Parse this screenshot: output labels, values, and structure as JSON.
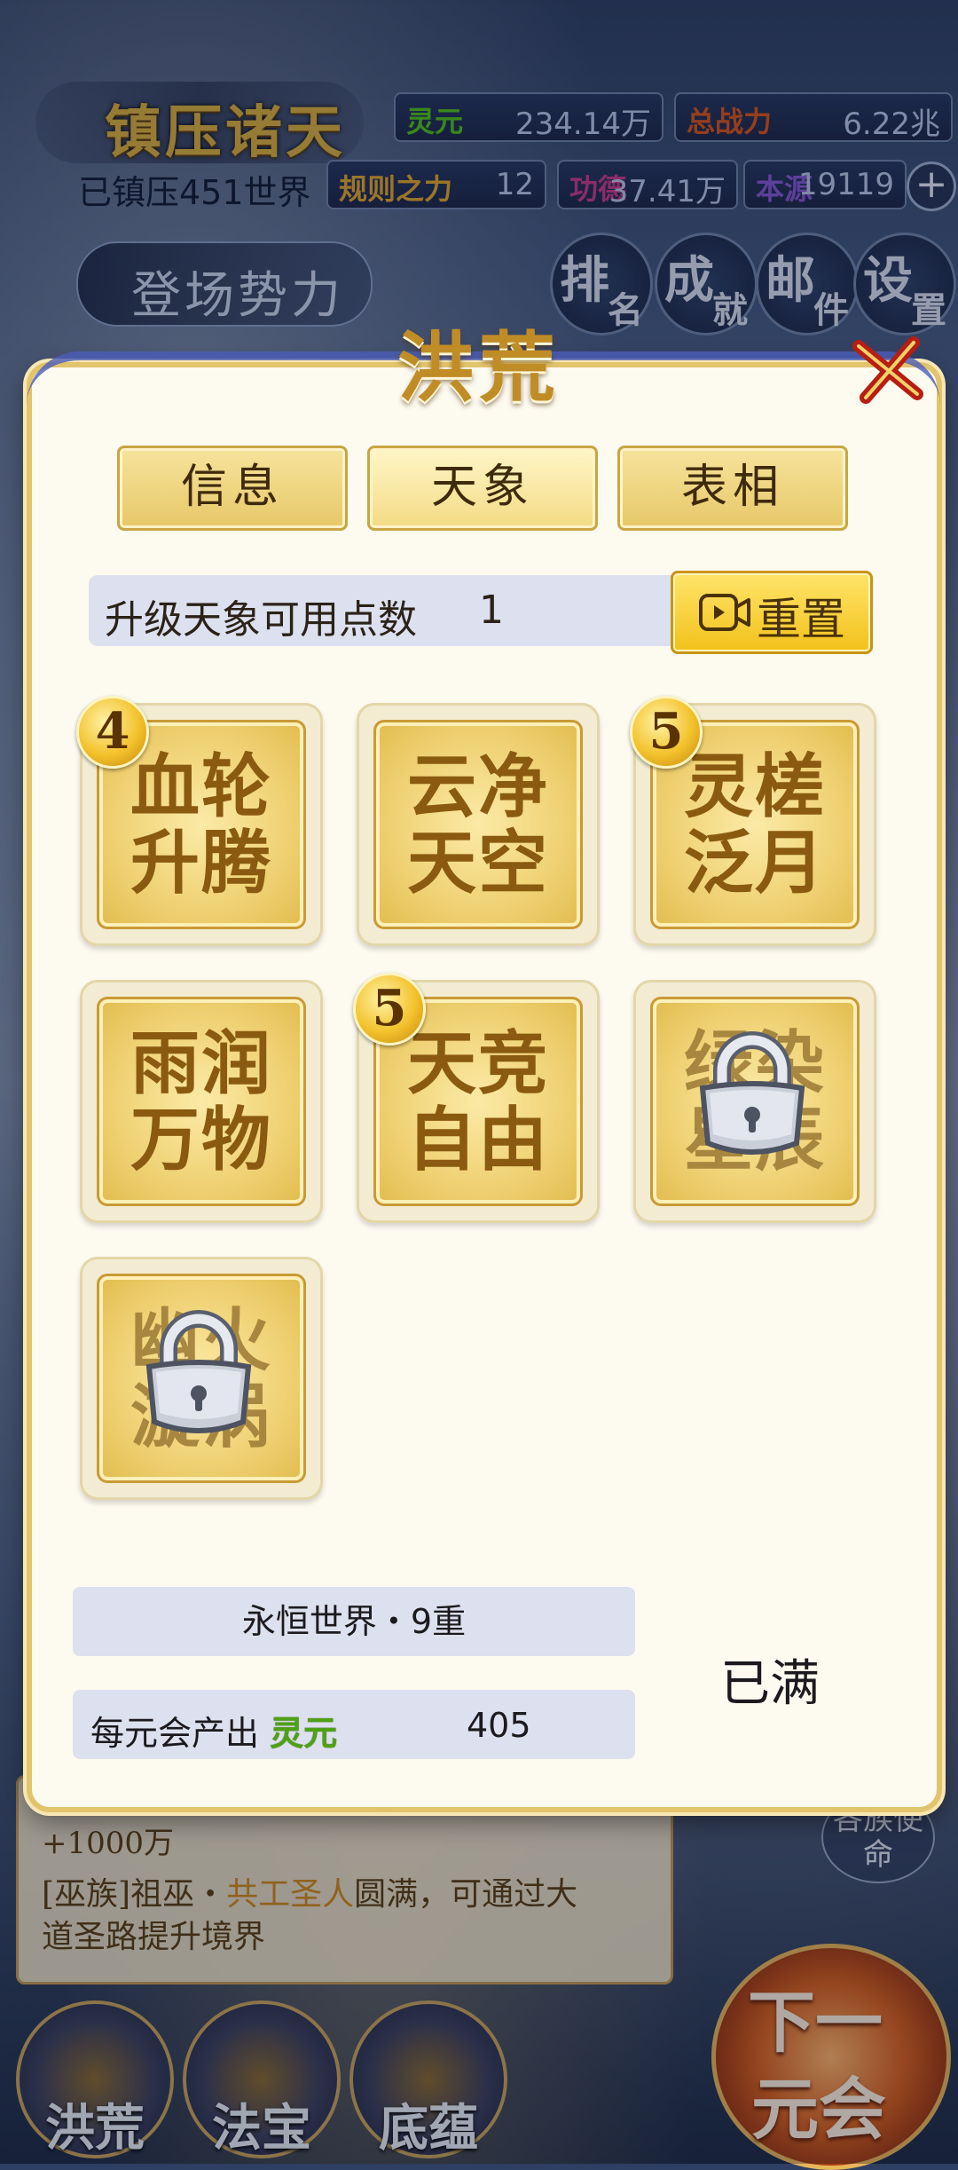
{
  "hud": {
    "title": "镇压诸天",
    "subtitle": "已镇压451世界",
    "stats": [
      {
        "label": "灵元",
        "value": "234.14万",
        "color": "#4fc21a"
      },
      {
        "label": "总战力",
        "value": "6.22兆",
        "color": "#d8541a"
      },
      {
        "label": "规则之力",
        "value": "12",
        "color": "#e0a52b"
      },
      {
        "label": "功德",
        "value": "37.41万",
        "color": "#c73a8a"
      },
      {
        "label": "本源",
        "value": "19119",
        "color": "#8457d3"
      }
    ],
    "plus": "+",
    "faction_button": "登场势力",
    "buttons": [
      {
        "main": "排",
        "small": "名"
      },
      {
        "main": "成",
        "small": "就"
      },
      {
        "main": "邮",
        "small": "件"
      },
      {
        "main": "设",
        "small": "置"
      }
    ]
  },
  "background": {
    "line1": "+1000万",
    "line2_prefix": "[巫族]祖巫・",
    "line2_highlight": "共工圣人",
    "line2_suffix": "圆满，可通过大",
    "line3": "道圣路提升境界",
    "mission": "各族使命",
    "nav": [
      "洪荒",
      "法宝",
      "底蕴"
    ],
    "next_button": [
      "下一",
      "元会"
    ]
  },
  "modal": {
    "title": "洪荒",
    "tabs": [
      "信息",
      "天象",
      "表相"
    ],
    "active_tab": 1,
    "points_label": "升级天象可用点数",
    "points_value": "1",
    "reset_label": "重置",
    "cards": [
      {
        "name": "血轮升腾",
        "line1": "血轮",
        "line2": "升腾",
        "level": "4",
        "locked": false
      },
      {
        "name": "云净天空",
        "line1": "云净",
        "line2": "天空",
        "level": "",
        "locked": false
      },
      {
        "name": "灵槎泛月",
        "line1": "灵槎",
        "line2": "泛月",
        "level": "5",
        "locked": false
      },
      {
        "name": "雨润万物",
        "line1": "雨润",
        "line2": "万物",
        "level": "",
        "locked": false
      },
      {
        "name": "天竞自由",
        "line1": "天竞",
        "line2": "自由",
        "level": "5",
        "locked": false
      },
      {
        "name": "绿染星辰",
        "line1": "绿染",
        "line2": "星辰",
        "level": "",
        "locked": true
      },
      {
        "name": "幽火漩涡",
        "line1": "幽火",
        "line2": "漩涡",
        "level": "",
        "locked": true
      }
    ],
    "world_level": "永恒世界・9重",
    "output_label": "每元会产出",
    "output_resource": "灵元",
    "output_value": "405",
    "status": "已满"
  }
}
